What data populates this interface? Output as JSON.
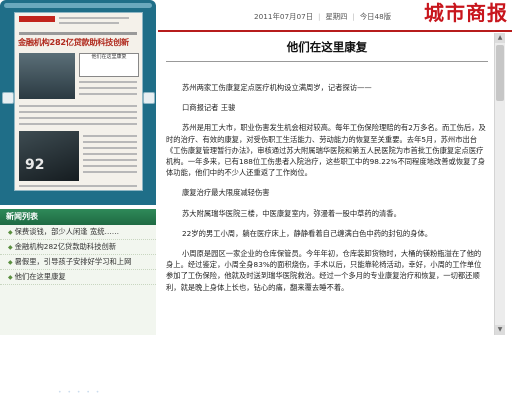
{
  "masthead": "城市商报",
  "date_bar": {
    "date": "2011年07月07日",
    "weekday": "星期四",
    "page_count": "今日48版"
  },
  "thumbnail": {
    "headline": "金融机构282亿贷款助科技创新",
    "box_text": "他们在这里康复",
    "photo_number": "92"
  },
  "news_list": {
    "heading": "新闻列表",
    "items": [
      "保费谈钱，部少人闲逢 宽统……",
      "金融机构282亿贷款助科技创新",
      "暑假里，引导孩子安排好学习和上网",
      "他们在这里康复"
    ]
  },
  "article": {
    "title": "他们在这里康复",
    "paragraphs": [
      "苏州两家工伤康复定点医疗机构设立满周岁，记者探访——",
      "口商报记者  王骏",
      "苏州是用工大市，职业伤害发生机会相对较高。每年工伤保险理赔的有2万多名。而工伤后，及时的治疗、有效的康复，对受伤职工生活能力、劳动能力的恢复至关重要。去年5月，苏州市出台《工伤康复管理暂行办法》，审核通过苏大附属瑞华医院和第五人民医院为市首批工伤康复定点医疗机构。一年多来，已有188位工伤患者入院治疗，这些职工中的98.22%不同程度地改善或恢复了身体功能，他们中的不少人还重返了工作岗位。",
      "康复治疗最大限度减轻伤害",
      "苏大附属瑞华医院三楼，中医康复室内，弥漫着一股中草药的清香。",
      "22岁的男工小周，躺在医疗床上，静静看着自己缠满白色中药的封包的身体。",
      "小周原是园区一家企业的仓库保管员。今年年初，仓库装卸货物时，大桶的镁粉瓶溢在了他的身上。经过鉴定，小周全身83%的面积烧伤，手术以后，只能靠轮椅活动，幸好，小周的工作单位参加了工伤保险，他就及时送到瑞华医院救治。经过一个多月的专业康复治疗和恢复，一切都还顺利，就是晚上身体上长也，钻心的痛，翻来覆去睡不着。"
    ]
  }
}
